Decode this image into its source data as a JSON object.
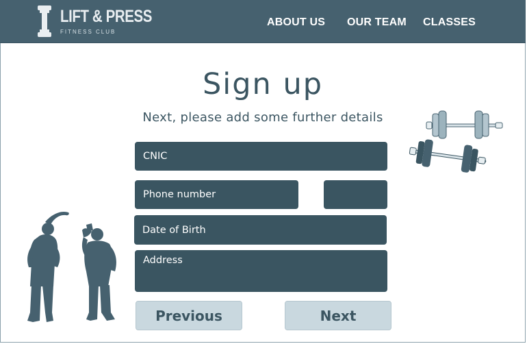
{
  "brand": {
    "name": "LIFT & PRESS",
    "tagline": "FITNESS CLUB"
  },
  "nav": {
    "items": [
      {
        "label": "ABOUT US"
      },
      {
        "label": "OUR TEAM"
      },
      {
        "label": "CLASSES"
      }
    ]
  },
  "form": {
    "title": "Sign up",
    "subtitle": "Next, please add some further details",
    "cnic_placeholder": "CNIC",
    "phone_placeholder": "Phone number",
    "phone_extra_placeholder": "",
    "dob_placeholder": "Date of Birth",
    "address_placeholder": "Address",
    "previous_label": "Previous",
    "next_label": "Next"
  },
  "colors": {
    "navbar": "#46616f",
    "field": "#3a5561",
    "button": "#c9d8df",
    "text": "#3b5561"
  },
  "icons": [
    "dumbbell-logo-icon",
    "dumbbells-illustration",
    "stretching-people-illustration"
  ]
}
